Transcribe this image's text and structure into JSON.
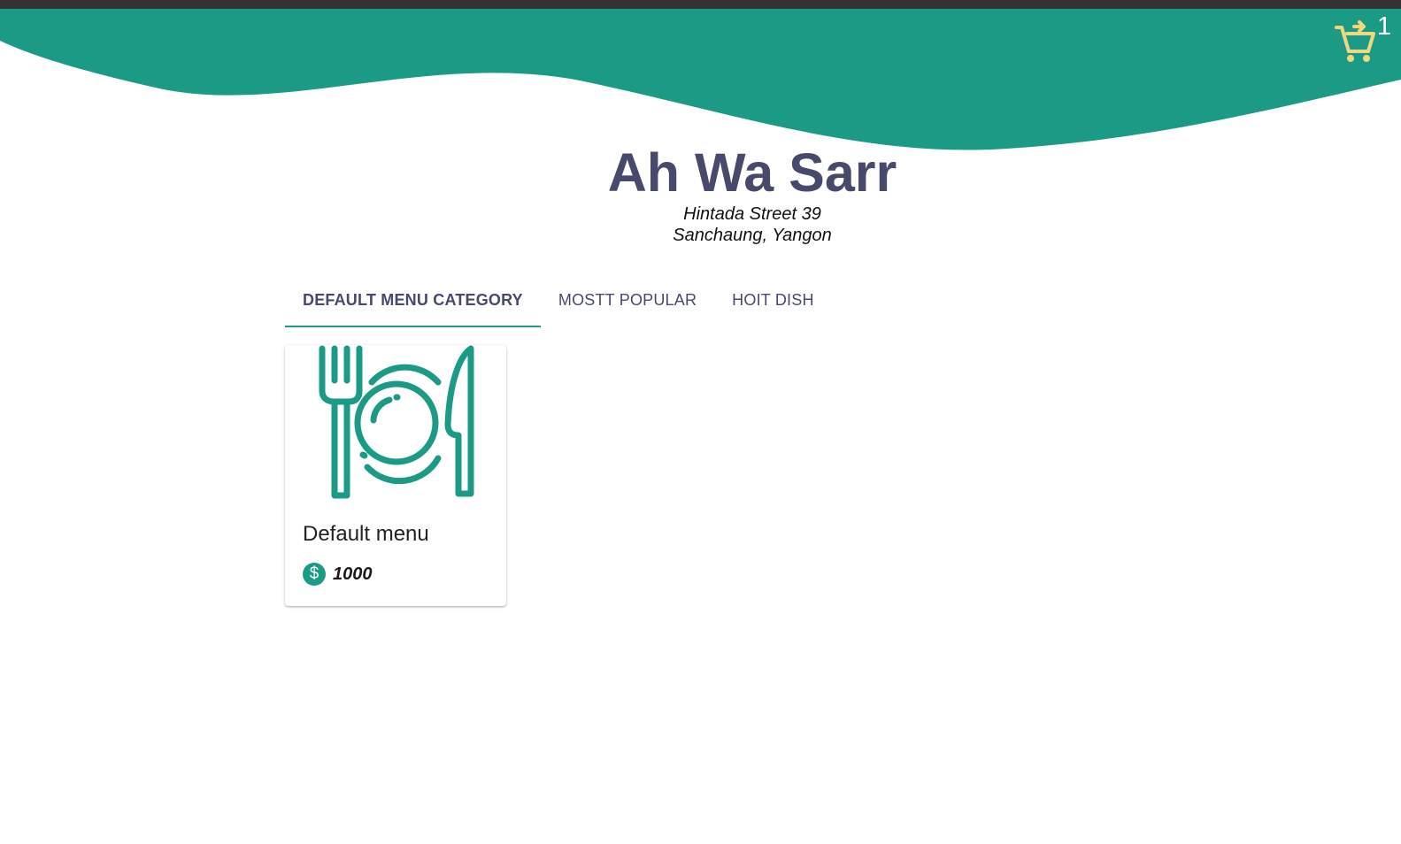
{
  "colors": {
    "topbar": "#333333",
    "brand": "#1b9b85",
    "title": "#474a6b",
    "cart": "#f3d77c"
  },
  "cart": {
    "icon": "cart-icon",
    "count": "1"
  },
  "restaurant": {
    "name": "Ah Wa Sarr",
    "address_line1": "Hintada Street 39",
    "address_line2": "Sanchaung, Yangon"
  },
  "tabs": [
    {
      "label": "DEFAULT MENU CATEGORY",
      "active": true
    },
    {
      "label": "MOSTT POPULAR",
      "active": false
    },
    {
      "label": "HOIT DISH",
      "active": false
    }
  ],
  "menu_items": [
    {
      "icon": "plate-fork-knife-icon",
      "name": "Default menu",
      "price_icon": "dollar-icon",
      "price": "1000"
    }
  ]
}
